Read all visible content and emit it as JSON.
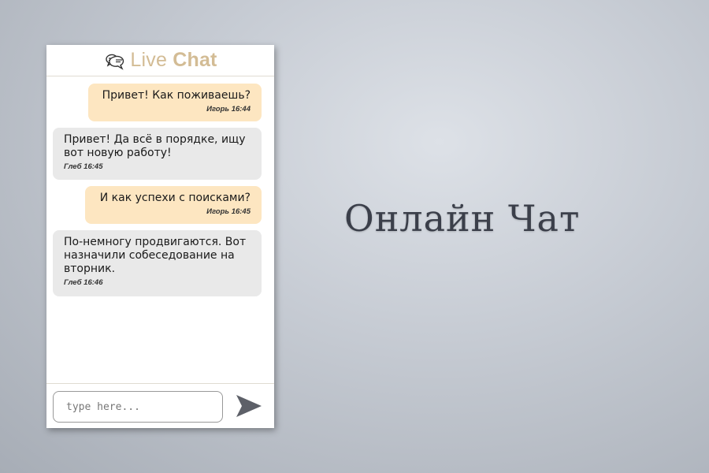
{
  "header": {
    "logo_icon": "chat-bubbles-icon",
    "title_light": "Live ",
    "title_bold": "Chat",
    "accent_color": "#d3bc95"
  },
  "messages": [
    {
      "direction": "out",
      "text": "Привет! Как поживаешь?",
      "meta": "Игорь 16:44"
    },
    {
      "direction": "in",
      "text": "Привет! Да всё в порядке, ищу вот новую работу!",
      "meta": "Глеб 16:45"
    },
    {
      "direction": "out",
      "text": "И как успехи с поисками?",
      "meta": "Игорь 16:45"
    },
    {
      "direction": "in",
      "text": "По-немногу продвигаются. Вот назначили собеседование на вторник.",
      "meta": "Глеб 16:46"
    }
  ],
  "composer": {
    "placeholder": "type here...",
    "send_icon": "send-icon"
  },
  "headline": "Онлайн Чат",
  "colors": {
    "outgoing_bubble": "#fde6c1",
    "incoming_bubble": "#e9e9e9"
  }
}
